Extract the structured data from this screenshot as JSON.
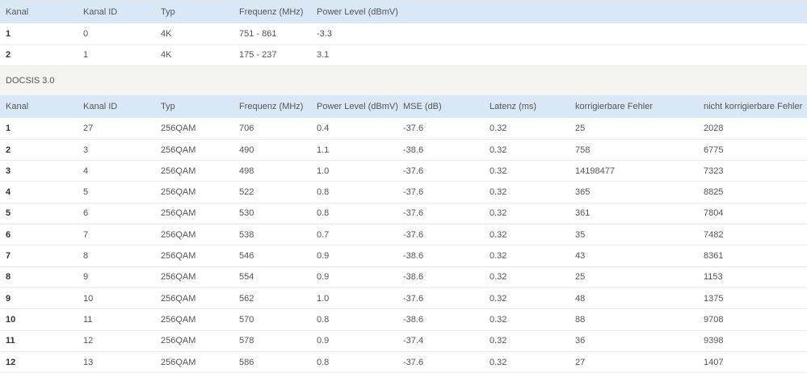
{
  "docsis31": {
    "headers": [
      "Kanal",
      "Kanal ID",
      "Typ",
      "Frequenz (MHz)",
      "Power Level (dBmV)"
    ],
    "rows": [
      [
        "1",
        "0",
        "4K",
        "751 - 861",
        "-3.3"
      ],
      [
        "2",
        "1",
        "4K",
        "175 - 237",
        "3.1"
      ]
    ]
  },
  "docsis30": {
    "title": "DOCSIS 3.0",
    "headers": [
      "Kanal",
      "Kanal ID",
      "Typ",
      "Frequenz (MHz)",
      "Power Level (dBmV)",
      "MSE (dB)",
      "Latenz (ms)",
      "korrigierbare Fehler",
      "nicht korrigierbare Fehler"
    ],
    "rows": [
      [
        "1",
        "27",
        "256QAM",
        "706",
        "0.4",
        "-37.6",
        "0.32",
        "25",
        "2028"
      ],
      [
        "2",
        "3",
        "256QAM",
        "490",
        "1.1",
        "-38.6",
        "0.32",
        "758",
        "6775"
      ],
      [
        "3",
        "4",
        "256QAM",
        "498",
        "1.0",
        "-37.6",
        "0.32",
        "14198477",
        "7323"
      ],
      [
        "4",
        "5",
        "256QAM",
        "522",
        "0.8",
        "-37.6",
        "0.32",
        "365",
        "8825"
      ],
      [
        "5",
        "6",
        "256QAM",
        "530",
        "0.8",
        "-37.6",
        "0.32",
        "361",
        "7804"
      ],
      [
        "6",
        "7",
        "256QAM",
        "538",
        "0.7",
        "-37.6",
        "0.32",
        "35",
        "7482"
      ],
      [
        "7",
        "8",
        "256QAM",
        "546",
        "0.9",
        "-38.6",
        "0.32",
        "43",
        "8361"
      ],
      [
        "8",
        "9",
        "256QAM",
        "554",
        "0.9",
        "-38.6",
        "0.32",
        "25",
        "1153"
      ],
      [
        "9",
        "10",
        "256QAM",
        "562",
        "1.0",
        "-37.6",
        "0.32",
        "48",
        "1375"
      ],
      [
        "10",
        "11",
        "256QAM",
        "570",
        "0.8",
        "-38.6",
        "0.32",
        "88",
        "9708"
      ],
      [
        "11",
        "12",
        "256QAM",
        "578",
        "0.9",
        "-37.4",
        "0.32",
        "36",
        "9398"
      ],
      [
        "12",
        "13",
        "256QAM",
        "586",
        "0.8",
        "-37.6",
        "0.32",
        "27",
        "1407"
      ]
    ]
  }
}
